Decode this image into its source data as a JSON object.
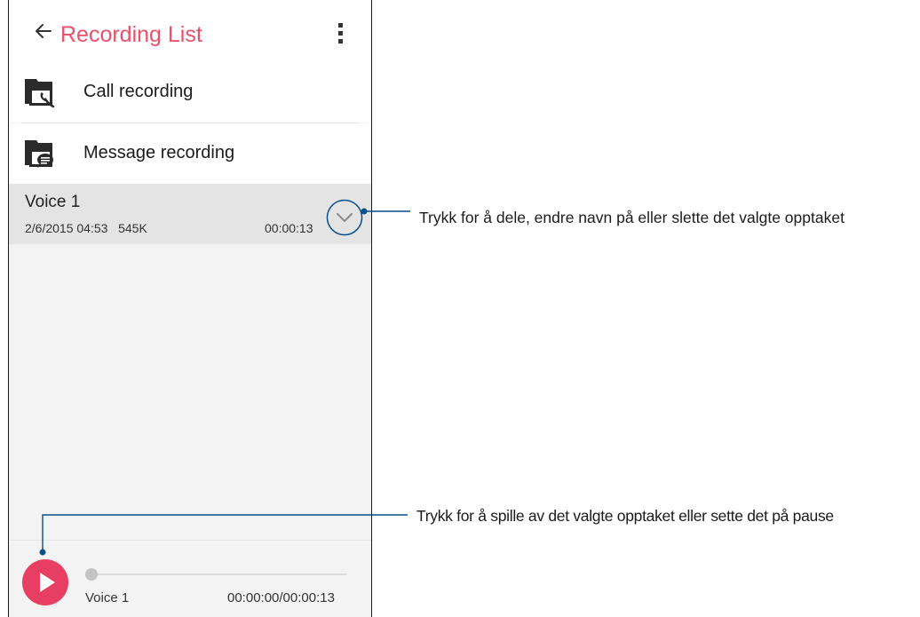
{
  "app_bar": {
    "title": "Recording List",
    "back_icon": "arrow-left-icon",
    "menu_icon": "more-vertical-icon",
    "accent_color": "#e9506b"
  },
  "folders": [
    {
      "label": "Call recording",
      "icon": "call-recording-folder-icon"
    },
    {
      "label": "Message recording",
      "icon": "message-recording-folder-icon"
    }
  ],
  "recording": {
    "name": "Voice 1",
    "date": "2/6/2015 04:53",
    "size": "545K",
    "duration": "00:00:13",
    "expand_icon": "chevron-down-icon"
  },
  "player": {
    "track_name": "Voice 1",
    "time": "00:00:00/00:00:13",
    "progress": 0,
    "play_icon": "play-icon",
    "play_color": "#e83e63"
  },
  "callouts": {
    "options": "Trykk for å dele, endre navn på eller slette det valgte opptaket",
    "play": "Trykk for å spille av det valgte opptaket eller sette det på pause",
    "line_color": "#0b4f8a"
  }
}
